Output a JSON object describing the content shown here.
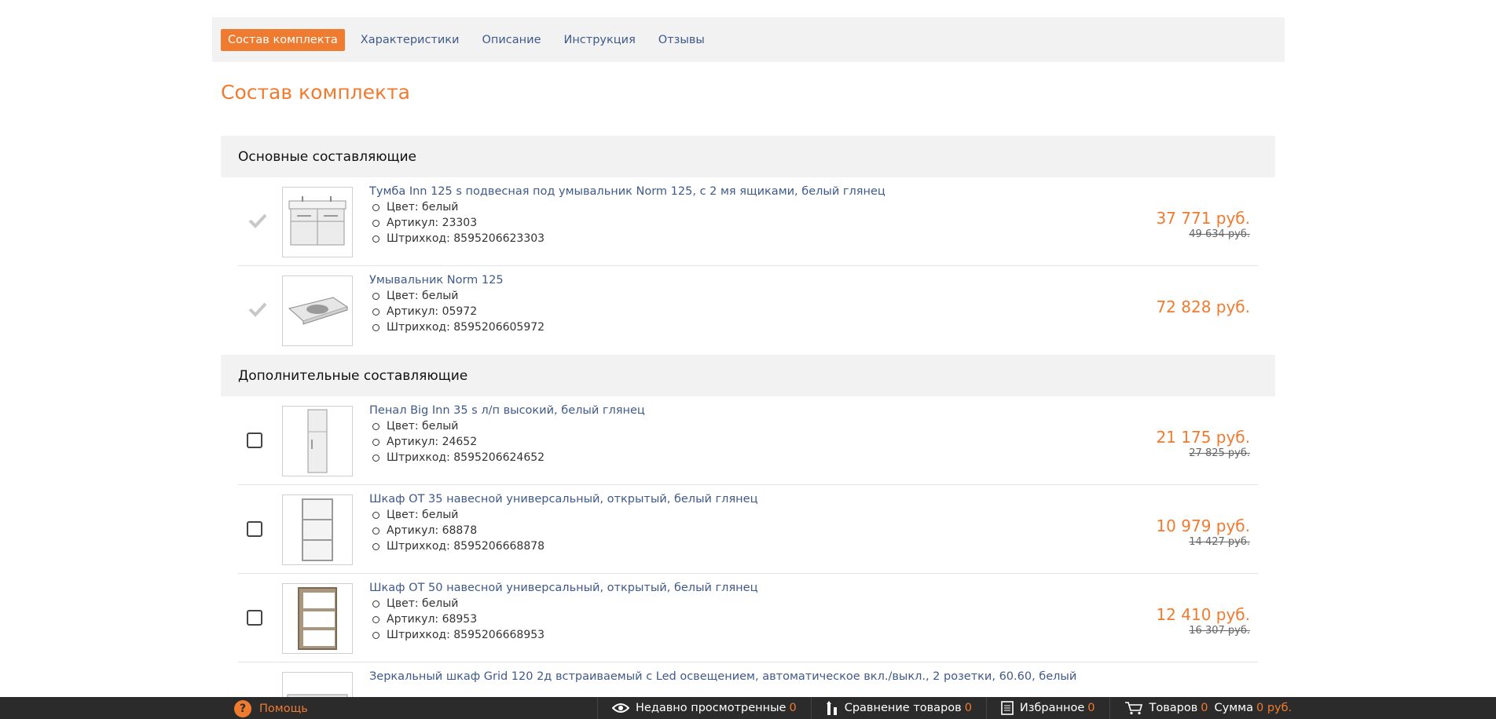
{
  "tabs": [
    {
      "label": "Состав комплекта",
      "active": true
    },
    {
      "label": "Характеристики",
      "active": false
    },
    {
      "label": "Описание",
      "active": false
    },
    {
      "label": "Инструкция",
      "active": false
    },
    {
      "label": "Отзывы",
      "active": false
    }
  ],
  "section_title": "Состав комплекта",
  "groups": {
    "main": {
      "title": "Основные составляющие",
      "items": [
        {
          "name": "Тумба Inn 125 s подвесная под умывальник Norm 125, с 2 мя ящиками, белый глянец",
          "color": "Цвет: белый",
          "sku": "Артикул: 23303",
          "barcode": "Штрихкод: 8595206623303",
          "price": "37 771 руб.",
          "old_price": "49 634 руб.",
          "icon": "check-icon",
          "thumb": "cabinet-double-sink"
        },
        {
          "name": "Умывальник Norm 125",
          "color": "Цвет: белый",
          "sku": "Артикул: 05972",
          "barcode": "Штрихкод: 8595206605972",
          "price": "72 828 руб.",
          "icon": "check-icon",
          "thumb": "washbasin"
        }
      ]
    },
    "extra": {
      "title": "Дополнительные составляющие",
      "items": [
        {
          "name": "Пенал Big Inn 35 s л/п высокий, белый глянец",
          "color": "Цвет: белый",
          "sku": "Артикул: 24652",
          "barcode": "Штрихкод: 8595206624652",
          "price": "21 175 руб.",
          "old_price": "27 825 руб.",
          "thumb": "tall-cabinet"
        },
        {
          "name": "Шкаф OT 35 навесной универсальный, открытый, белый глянец",
          "color": "Цвет: белый",
          "sku": "Артикул: 68878",
          "barcode": "Штрихкод: 8595206668878",
          "price": "10 979 руб.",
          "old_price": "14 427 руб.",
          "thumb": "open-shelf-white"
        },
        {
          "name": "Шкаф OT 50 навесной универсальный, открытый, белый глянец",
          "color": "Цвет: белый",
          "sku": "Артикул: 68953",
          "barcode": "Штрихкод: 8595206668953",
          "price": "12 410 руб.",
          "old_price": "16 307 руб.",
          "thumb": "open-shelf-wood"
        },
        {
          "name": "Зеркальный шкаф Grid 120 2д встраиваемый с Led освещением, автоматическое вкл./выкл., 2 розетки, 60.60, белый",
          "thumb": "mirror-cabinet"
        }
      ]
    }
  },
  "footer": {
    "help": "Помощь",
    "recent": {
      "label": "Недавно просмотренные",
      "count": "0"
    },
    "compare": {
      "label": "Сравнение товаров",
      "count": "0"
    },
    "favorites": {
      "label": "Избранное",
      "count": "0"
    },
    "cart": {
      "items_label": "Товаров",
      "items_count": "0",
      "sum_label": "Сумма",
      "sum_value": "0 руб."
    }
  },
  "colors": {
    "accent": "#ef7b30",
    "link": "#3f5a8a",
    "panel": "#f2f2f2",
    "footer": "#2b2b2b"
  }
}
